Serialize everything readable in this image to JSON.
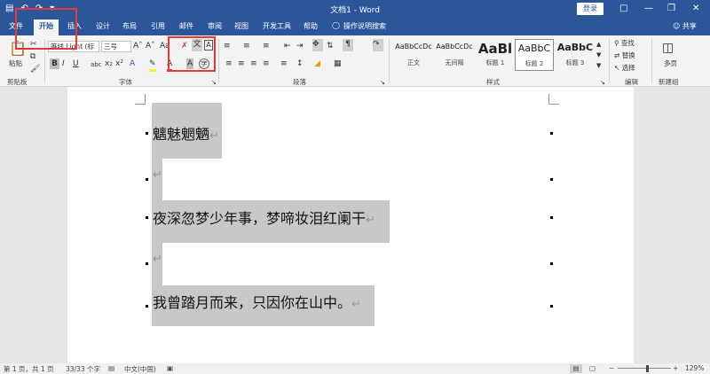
{
  "app": {
    "title": "文档1 - Word",
    "login": "登录",
    "share": "共享"
  },
  "qat": {
    "save_icon": "save-icon",
    "undo_icon": "undo-icon",
    "redo_icon": "redo-icon",
    "customize_icon": "customize-icon"
  },
  "tabs": [
    "文件",
    "开始",
    "插入",
    "设计",
    "布局",
    "引用",
    "邮件",
    "审阅",
    "视图",
    "开发工具",
    "帮助"
  ],
  "tell_me": "操作说明搜索",
  "ribbon": {
    "clipboard": {
      "paste": "粘贴",
      "label": "剪贴板"
    },
    "font": {
      "font_name": "等线 Light (标",
      "font_size": "三号",
      "label": "字体"
    },
    "paragraph": {
      "label": "段落"
    },
    "styles": {
      "label": "样式",
      "items": [
        {
          "sample": "AaBbCcDc",
          "name": "正文"
        },
        {
          "sample": "AaBbCcDc",
          "name": "无间隔"
        },
        {
          "sample": "AaBl",
          "name": "标题 1"
        },
        {
          "sample": "AaBbC",
          "name": "标题 2"
        },
        {
          "sample": "AaBbC",
          "name": "标题 3"
        }
      ]
    },
    "editing": {
      "find": "查找",
      "replace": "替换",
      "select": "选择",
      "label": "编辑"
    },
    "new_group": {
      "multipage": "多页",
      "label": "新建组"
    }
  },
  "document": {
    "lines": [
      "魑魅魍魉",
      "",
      "夜深忽梦少年事，梦啼妆泪红阑干",
      "",
      "我曾踏月而来，只因你在山中。"
    ],
    "paragraph_mark": "↵"
  },
  "status": {
    "page": "第 1 页，共 1 页",
    "words": "33/33 个字",
    "language": "中文(中国)",
    "zoom": "129%"
  },
  "colors": {
    "accent": "#2b579a",
    "annotation": "#e53935",
    "selection": "#c8c8c8"
  }
}
